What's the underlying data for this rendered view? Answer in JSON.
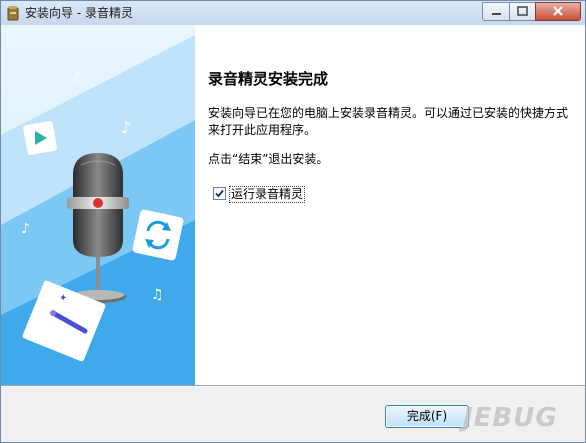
{
  "window": {
    "title": "安装向导 - 录音精灵"
  },
  "content": {
    "heading": "录音精灵安装完成",
    "description": "安装向导已在您的电脑上安装录音精灵。可以通过已安装的快捷方式来打开此应用程序。",
    "hint": "点击“结束”退出安装。"
  },
  "options": {
    "launch_label": "运行录音精灵",
    "launch_checked": true
  },
  "buttons": {
    "finish": "完成(F)"
  },
  "watermark": "JEBUG"
}
